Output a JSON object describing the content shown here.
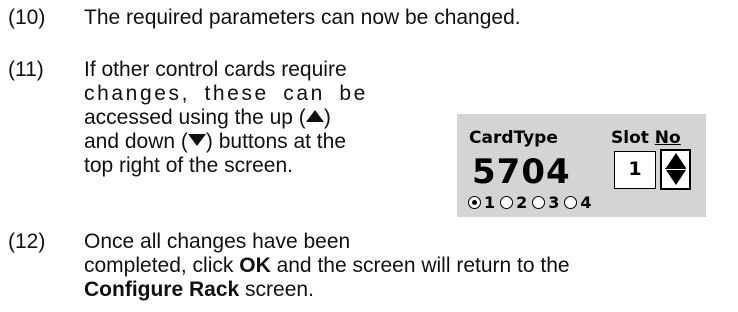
{
  "steps": [
    {
      "number": "(10)",
      "lines": [
        "The required parameters can now be changed."
      ]
    },
    {
      "number": "(11)",
      "lines": [
        "If other control cards require",
        "changes, these can be",
        "accessed using the up (",
        ")",
        "and down (",
        ") buttons at the",
        "top right of the screen."
      ]
    },
    {
      "number": "(12)",
      "line1": "Once all changes have been",
      "line2_a": "completed, click ",
      "line2_bold": "OK",
      "line2_b": " and the screen will return to the",
      "line3_bold": "Configure Rack",
      "line3_b": " screen."
    }
  ],
  "panel": {
    "card_type_label": "CardType",
    "slot_label_a": "Slot ",
    "slot_label_b": "No",
    "card_type_value": "5704",
    "slot_value": "1",
    "radio_options": [
      "1",
      "2",
      "3",
      "4"
    ],
    "selected_radio": "1"
  },
  "icons": [
    "up-triangle-icon",
    "down-triangle-icon",
    "spinner-up-icon",
    "spinner-down-icon"
  ]
}
